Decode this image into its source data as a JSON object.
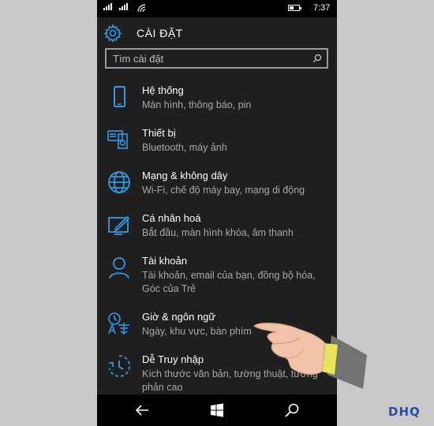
{
  "status_bar": {
    "time": "7:37"
  },
  "header": {
    "title": "CÀI ĐẶT",
    "icon": "gear-icon"
  },
  "search": {
    "placeholder": "Tìm cài đặt"
  },
  "accent_color": "#2d9be8",
  "settings": [
    {
      "title": "Hệ thống",
      "subtitle": "Màn hình, thông báo, pin",
      "icon": "phone-icon"
    },
    {
      "title": "Thiết bị",
      "subtitle": "Bluetooth, máy ảnh",
      "icon": "devices-icon"
    },
    {
      "title": "Mạng & không dây",
      "subtitle": "Wi-Fi, chế độ máy bay, mạng di động",
      "icon": "globe-icon"
    },
    {
      "title": "Cá nhân hoá",
      "subtitle": "Bắt đầu, màn hình khóa, âm thanh",
      "icon": "personalize-icon"
    },
    {
      "title": "Tài khoản",
      "subtitle": "Tài khoản, email của bạn, đồng bộ hóa, Góc của Trẻ",
      "icon": "person-icon"
    },
    {
      "title": "Giờ & ngôn ngữ",
      "subtitle": "Ngày, khu vực, bàn phím",
      "icon": "time-language-icon"
    },
    {
      "title": "Dễ Truy nhập",
      "subtitle": "Kích thước văn bản, tường thuật, tương phản cao",
      "icon": "ease-of-access-icon"
    }
  ],
  "watermark": "DHQ"
}
